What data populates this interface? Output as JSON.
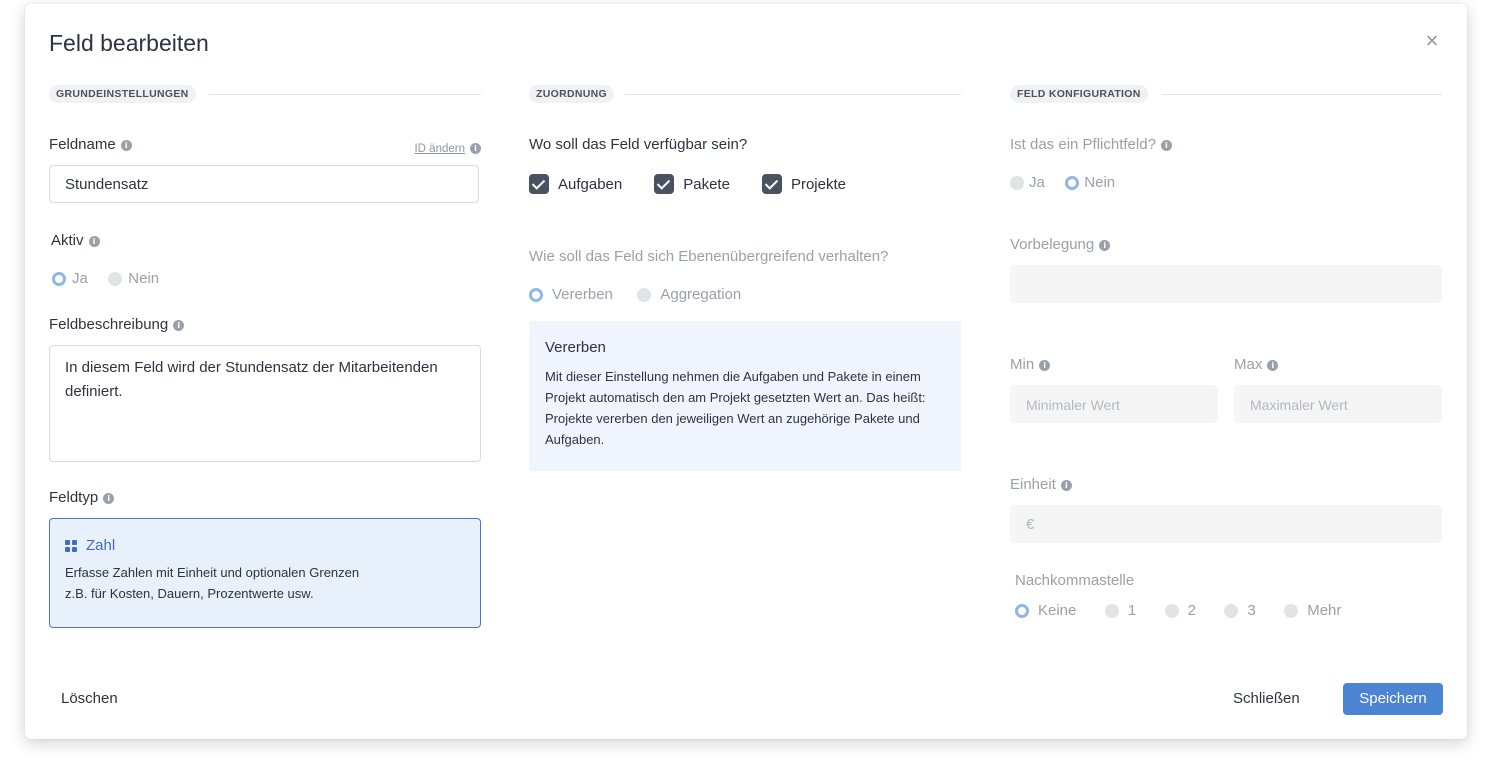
{
  "dialog": {
    "title": "Feld bearbeiten",
    "close_icon": "×"
  },
  "sections": {
    "basic": "GRUNDEINSTELLUNGEN",
    "assignment": "ZUORDNUNG",
    "config": "FELD KONFIGURATION"
  },
  "basic": {
    "fieldname_label": "Feldname",
    "change_id_link": "ID ändern",
    "fieldname_value": "Stundensatz",
    "active_label": "Aktiv",
    "active_options": [
      "Ja",
      "Nein"
    ],
    "active_selected": "Ja",
    "description_label": "Feldbeschreibung",
    "description_value": "In diesem Feld wird der Stundensatz der Mitarbeitenden definiert.",
    "type_label": "Feldtyp",
    "type_name": "Zahl",
    "type_icon": "grid-icon",
    "type_description_1": "Erfasse Zahlen mit Einheit und optionalen Grenzen",
    "type_description_2": "z.B. für Kosten, Dauern, Prozentwerte usw."
  },
  "assignment": {
    "availability_question": "Wo soll das Feld verfügbar sein?",
    "availability_options": [
      "Aufgaben",
      "Pakete",
      "Projekte"
    ],
    "inheritance_question": "Wie soll das Feld sich Ebenenübergreifend verhalten?",
    "inheritance_options": [
      "Vererben",
      "Aggregation"
    ],
    "inheritance_selected": "Vererben",
    "info_title": "Vererben",
    "info_text": "Mit dieser Einstellung nehmen die Aufgaben und Pakete in einem Projekt automatisch den am Projekt gesetzten Wert an. Das heißt: Projekte vererben den jeweiligen Wert an zugehörige Pakete und Aufgaben."
  },
  "config": {
    "required_label": "Ist das ein Pflichtfeld?",
    "required_options": [
      "Ja",
      "Nein"
    ],
    "required_selected": "Nein",
    "default_label": "Vorbelegung",
    "default_value": "",
    "min_label": "Min",
    "min_placeholder": "Minimaler Wert",
    "max_label": "Max",
    "max_placeholder": "Maximaler Wert",
    "unit_label": "Einheit",
    "unit_value": "€",
    "decimals_label": "Nachkommastelle",
    "decimals_options": [
      "Keine",
      "1",
      "2",
      "3",
      "Mehr"
    ],
    "decimals_selected": "Keine"
  },
  "footer": {
    "delete_label": "Löschen",
    "close_label": "Schließen",
    "save_label": "Speichern"
  },
  "colors": {
    "primary": "#4a84d2",
    "selected_card_bg": "#e8f0fb",
    "info_box_bg": "#f0f4fd",
    "checkbox": "#4a5160"
  }
}
